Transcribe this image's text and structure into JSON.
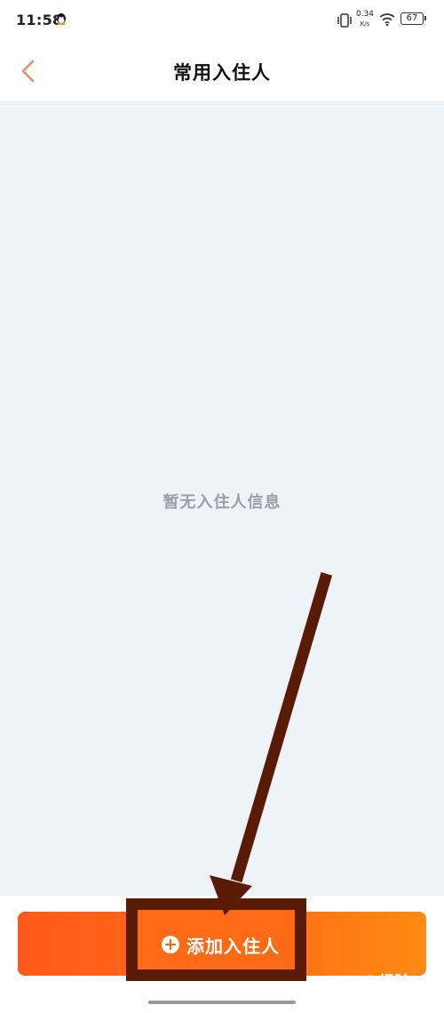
{
  "status_bar": {
    "time": "11:58",
    "net_speed_value": "0.34",
    "net_speed_unit": "K/s",
    "battery": "67"
  },
  "nav": {
    "title": "常用入住人"
  },
  "content": {
    "empty_message": "暂无入住人信息"
  },
  "footer": {
    "add_button_label": "添加入住人"
  },
  "watermark": {
    "text": "Bai 经验"
  },
  "colors": {
    "accent": "#ff6a16",
    "annotation": "#5a1b06",
    "background": "#eef3f8"
  }
}
